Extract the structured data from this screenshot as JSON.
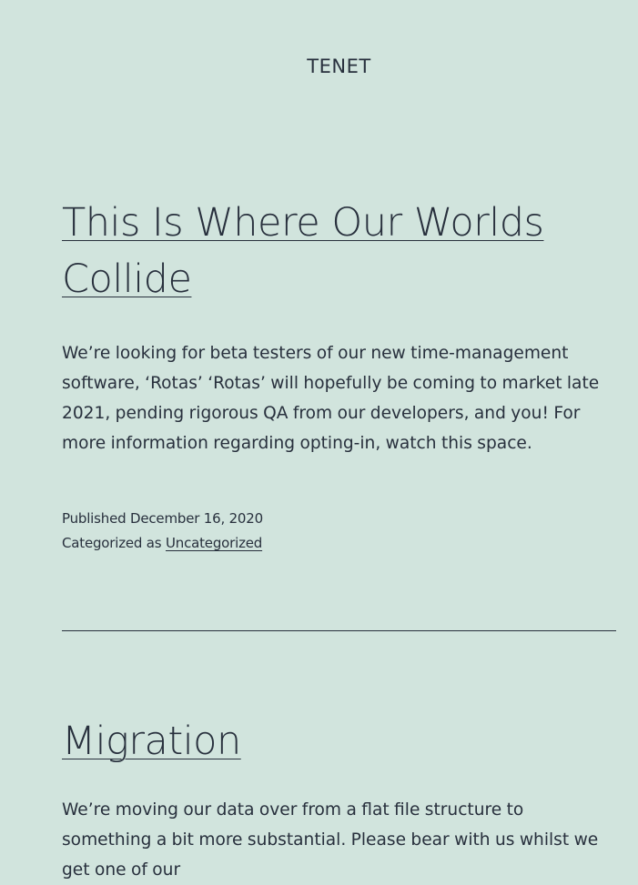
{
  "site": {
    "title": "TENET"
  },
  "posts": [
    {
      "title_line1": "This Is Where Our Worlds",
      "title_line2": "Collide",
      "excerpt": "We’re looking for beta testers of our new time-management software, ‘Rotas’ ‘Rotas’ will hopefully be coming to market late 2021, pending rigorous QA from our developers, and you! For more information regarding opting-in, watch this space.",
      "published_label": "Published",
      "published_date": "December 16, 2020",
      "categorized_label": "Categorized as",
      "category": "Uncategorized"
    },
    {
      "title": "Migration",
      "excerpt": "We’re moving our data over from a flat file structure to something a bit more substantial. Please bear with us whilst we get one of our"
    }
  ],
  "colors": {
    "background": "#d1e4dd",
    "text": "#28303d"
  }
}
